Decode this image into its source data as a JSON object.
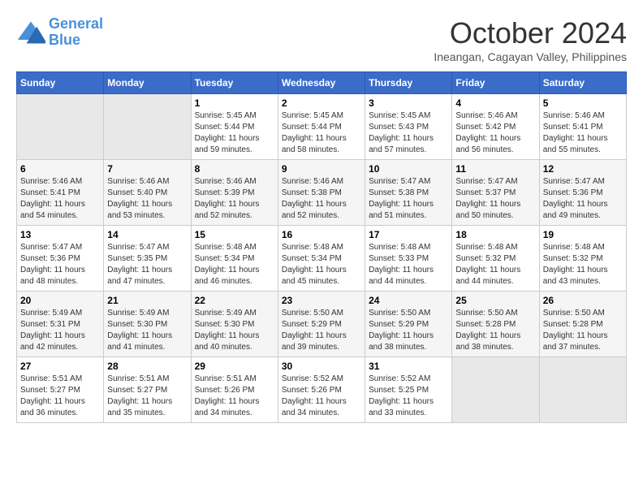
{
  "logo": {
    "line1": "General",
    "line2": "Blue"
  },
  "title": "October 2024",
  "subtitle": "Ineangan, Cagayan Valley, Philippines",
  "days_of_week": [
    "Sunday",
    "Monday",
    "Tuesday",
    "Wednesday",
    "Thursday",
    "Friday",
    "Saturday"
  ],
  "weeks": [
    [
      {
        "num": "",
        "sunrise": "",
        "sunset": "",
        "daylight": "",
        "empty": true
      },
      {
        "num": "",
        "sunrise": "",
        "sunset": "",
        "daylight": "",
        "empty": true
      },
      {
        "num": "1",
        "sunrise": "Sunrise: 5:45 AM",
        "sunset": "Sunset: 5:44 PM",
        "daylight": "Daylight: 11 hours and 59 minutes.",
        "empty": false
      },
      {
        "num": "2",
        "sunrise": "Sunrise: 5:45 AM",
        "sunset": "Sunset: 5:44 PM",
        "daylight": "Daylight: 11 hours and 58 minutes.",
        "empty": false
      },
      {
        "num": "3",
        "sunrise": "Sunrise: 5:45 AM",
        "sunset": "Sunset: 5:43 PM",
        "daylight": "Daylight: 11 hours and 57 minutes.",
        "empty": false
      },
      {
        "num": "4",
        "sunrise": "Sunrise: 5:46 AM",
        "sunset": "Sunset: 5:42 PM",
        "daylight": "Daylight: 11 hours and 56 minutes.",
        "empty": false
      },
      {
        "num": "5",
        "sunrise": "Sunrise: 5:46 AM",
        "sunset": "Sunset: 5:41 PM",
        "daylight": "Daylight: 11 hours and 55 minutes.",
        "empty": false
      }
    ],
    [
      {
        "num": "6",
        "sunrise": "Sunrise: 5:46 AM",
        "sunset": "Sunset: 5:41 PM",
        "daylight": "Daylight: 11 hours and 54 minutes.",
        "empty": false
      },
      {
        "num": "7",
        "sunrise": "Sunrise: 5:46 AM",
        "sunset": "Sunset: 5:40 PM",
        "daylight": "Daylight: 11 hours and 53 minutes.",
        "empty": false
      },
      {
        "num": "8",
        "sunrise": "Sunrise: 5:46 AM",
        "sunset": "Sunset: 5:39 PM",
        "daylight": "Daylight: 11 hours and 52 minutes.",
        "empty": false
      },
      {
        "num": "9",
        "sunrise": "Sunrise: 5:46 AM",
        "sunset": "Sunset: 5:38 PM",
        "daylight": "Daylight: 11 hours and 52 minutes.",
        "empty": false
      },
      {
        "num": "10",
        "sunrise": "Sunrise: 5:47 AM",
        "sunset": "Sunset: 5:38 PM",
        "daylight": "Daylight: 11 hours and 51 minutes.",
        "empty": false
      },
      {
        "num": "11",
        "sunrise": "Sunrise: 5:47 AM",
        "sunset": "Sunset: 5:37 PM",
        "daylight": "Daylight: 11 hours and 50 minutes.",
        "empty": false
      },
      {
        "num": "12",
        "sunrise": "Sunrise: 5:47 AM",
        "sunset": "Sunset: 5:36 PM",
        "daylight": "Daylight: 11 hours and 49 minutes.",
        "empty": false
      }
    ],
    [
      {
        "num": "13",
        "sunrise": "Sunrise: 5:47 AM",
        "sunset": "Sunset: 5:36 PM",
        "daylight": "Daylight: 11 hours and 48 minutes.",
        "empty": false
      },
      {
        "num": "14",
        "sunrise": "Sunrise: 5:47 AM",
        "sunset": "Sunset: 5:35 PM",
        "daylight": "Daylight: 11 hours and 47 minutes.",
        "empty": false
      },
      {
        "num": "15",
        "sunrise": "Sunrise: 5:48 AM",
        "sunset": "Sunset: 5:34 PM",
        "daylight": "Daylight: 11 hours and 46 minutes.",
        "empty": false
      },
      {
        "num": "16",
        "sunrise": "Sunrise: 5:48 AM",
        "sunset": "Sunset: 5:34 PM",
        "daylight": "Daylight: 11 hours and 45 minutes.",
        "empty": false
      },
      {
        "num": "17",
        "sunrise": "Sunrise: 5:48 AM",
        "sunset": "Sunset: 5:33 PM",
        "daylight": "Daylight: 11 hours and 44 minutes.",
        "empty": false
      },
      {
        "num": "18",
        "sunrise": "Sunrise: 5:48 AM",
        "sunset": "Sunset: 5:32 PM",
        "daylight": "Daylight: 11 hours and 44 minutes.",
        "empty": false
      },
      {
        "num": "19",
        "sunrise": "Sunrise: 5:48 AM",
        "sunset": "Sunset: 5:32 PM",
        "daylight": "Daylight: 11 hours and 43 minutes.",
        "empty": false
      }
    ],
    [
      {
        "num": "20",
        "sunrise": "Sunrise: 5:49 AM",
        "sunset": "Sunset: 5:31 PM",
        "daylight": "Daylight: 11 hours and 42 minutes.",
        "empty": false
      },
      {
        "num": "21",
        "sunrise": "Sunrise: 5:49 AM",
        "sunset": "Sunset: 5:30 PM",
        "daylight": "Daylight: 11 hours and 41 minutes.",
        "empty": false
      },
      {
        "num": "22",
        "sunrise": "Sunrise: 5:49 AM",
        "sunset": "Sunset: 5:30 PM",
        "daylight": "Daylight: 11 hours and 40 minutes.",
        "empty": false
      },
      {
        "num": "23",
        "sunrise": "Sunrise: 5:50 AM",
        "sunset": "Sunset: 5:29 PM",
        "daylight": "Daylight: 11 hours and 39 minutes.",
        "empty": false
      },
      {
        "num": "24",
        "sunrise": "Sunrise: 5:50 AM",
        "sunset": "Sunset: 5:29 PM",
        "daylight": "Daylight: 11 hours and 38 minutes.",
        "empty": false
      },
      {
        "num": "25",
        "sunrise": "Sunrise: 5:50 AM",
        "sunset": "Sunset: 5:28 PM",
        "daylight": "Daylight: 11 hours and 38 minutes.",
        "empty": false
      },
      {
        "num": "26",
        "sunrise": "Sunrise: 5:50 AM",
        "sunset": "Sunset: 5:28 PM",
        "daylight": "Daylight: 11 hours and 37 minutes.",
        "empty": false
      }
    ],
    [
      {
        "num": "27",
        "sunrise": "Sunrise: 5:51 AM",
        "sunset": "Sunset: 5:27 PM",
        "daylight": "Daylight: 11 hours and 36 minutes.",
        "empty": false
      },
      {
        "num": "28",
        "sunrise": "Sunrise: 5:51 AM",
        "sunset": "Sunset: 5:27 PM",
        "daylight": "Daylight: 11 hours and 35 minutes.",
        "empty": false
      },
      {
        "num": "29",
        "sunrise": "Sunrise: 5:51 AM",
        "sunset": "Sunset: 5:26 PM",
        "daylight": "Daylight: 11 hours and 34 minutes.",
        "empty": false
      },
      {
        "num": "30",
        "sunrise": "Sunrise: 5:52 AM",
        "sunset": "Sunset: 5:26 PM",
        "daylight": "Daylight: 11 hours and 34 minutes.",
        "empty": false
      },
      {
        "num": "31",
        "sunrise": "Sunrise: 5:52 AM",
        "sunset": "Sunset: 5:25 PM",
        "daylight": "Daylight: 11 hours and 33 minutes.",
        "empty": false
      },
      {
        "num": "",
        "sunrise": "",
        "sunset": "",
        "daylight": "",
        "empty": true
      },
      {
        "num": "",
        "sunrise": "",
        "sunset": "",
        "daylight": "",
        "empty": true
      }
    ]
  ]
}
